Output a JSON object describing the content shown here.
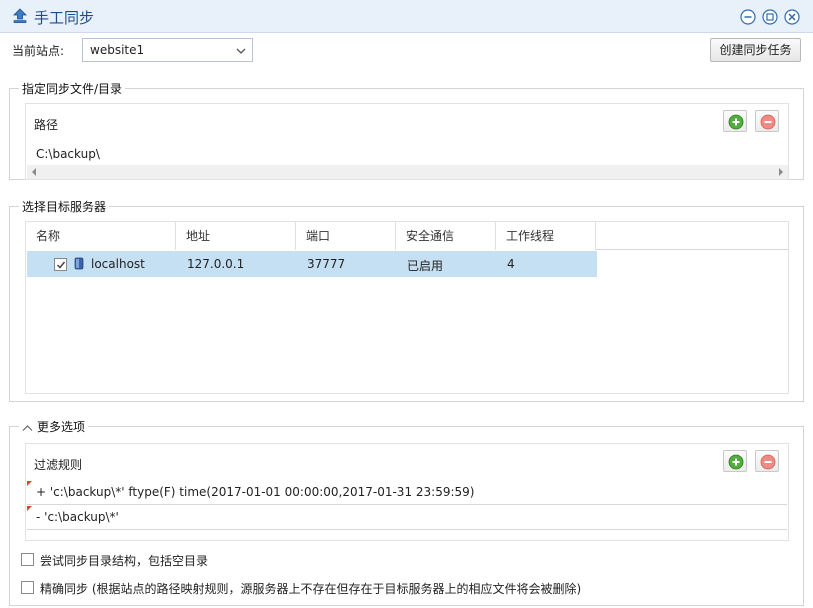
{
  "window": {
    "title": "手工同步",
    "controls": [
      "minimize-icon",
      "restore-icon",
      "close-icon"
    ],
    "accent": "#1d4e89"
  },
  "site": {
    "label": "当前站点:",
    "selected": "website1",
    "create_task": "创建同步任务"
  },
  "paths": {
    "group_title": "指定同步文件/目录",
    "header": "路径",
    "items": [
      "C:\\backup\\"
    ]
  },
  "servers": {
    "group_title": "选择目标服务器",
    "columns": [
      "名称",
      "地址",
      "端口",
      "安全通信",
      "工作线程"
    ],
    "rows": [
      {
        "checked": true,
        "name": "localhost",
        "address": "127.0.0.1",
        "port": "37777",
        "secure": "已启用",
        "threads": "4"
      }
    ],
    "selection_color": "#c5dff3"
  },
  "more": {
    "group_title": "更多选项",
    "filter_header": "过滤规则",
    "rules": [
      "+ 'c:\\backup\\*' ftype(F) time(2017-01-01 00:00:00,2017-01-31 23:59:59)",
      "- 'c:\\backup\\*'"
    ],
    "option_sync_dirs": "尝试同步目录结构，包括空目录",
    "option_exact": "精确同步 (根据站点的路径映射规则，源服务器上不存在但存在于目标服务器上的相应文件将会被删除)"
  }
}
